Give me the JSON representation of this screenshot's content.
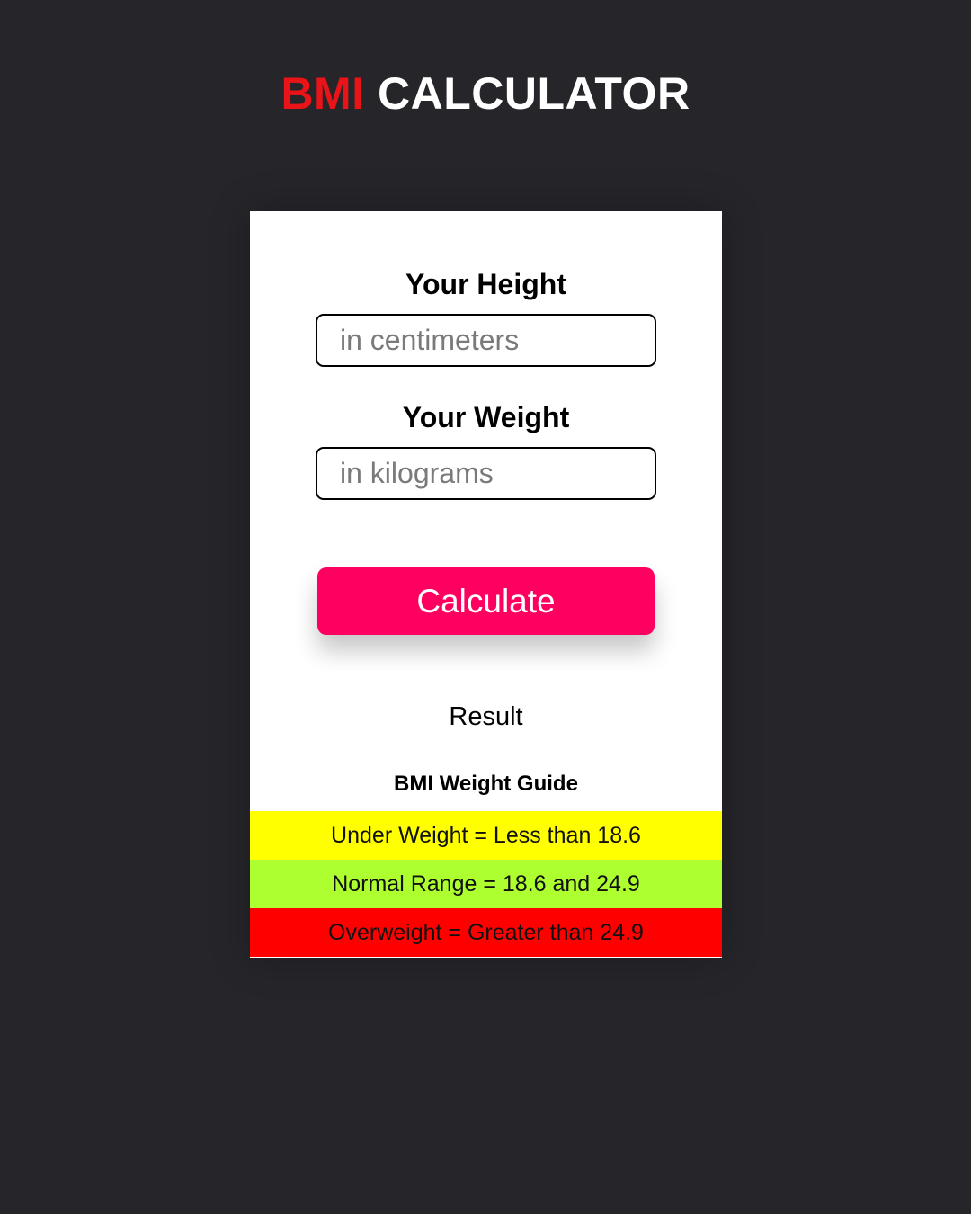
{
  "header": {
    "title_accent": "BMI",
    "title_main": "CALCULATOR",
    "accent_color": "#ea1418"
  },
  "form": {
    "height_label": "Your Height",
    "height_placeholder": "in centimeters",
    "height_value": "",
    "weight_label": "Your Weight",
    "weight_placeholder": "in kilograms",
    "weight_value": "",
    "calculate_label": "Calculate",
    "button_color": "#fe0060"
  },
  "result": {
    "text": "Result"
  },
  "guide": {
    "title": "BMI Weight Guide",
    "rows": [
      {
        "text": "Under Weight = Less than 18.6",
        "color": "#ffff00"
      },
      {
        "text": "Normal Range = 18.6 and 24.9",
        "color": "#adff2f"
      },
      {
        "text": "Overweight = Greater than 24.9",
        "color": "#ff0000"
      }
    ]
  }
}
